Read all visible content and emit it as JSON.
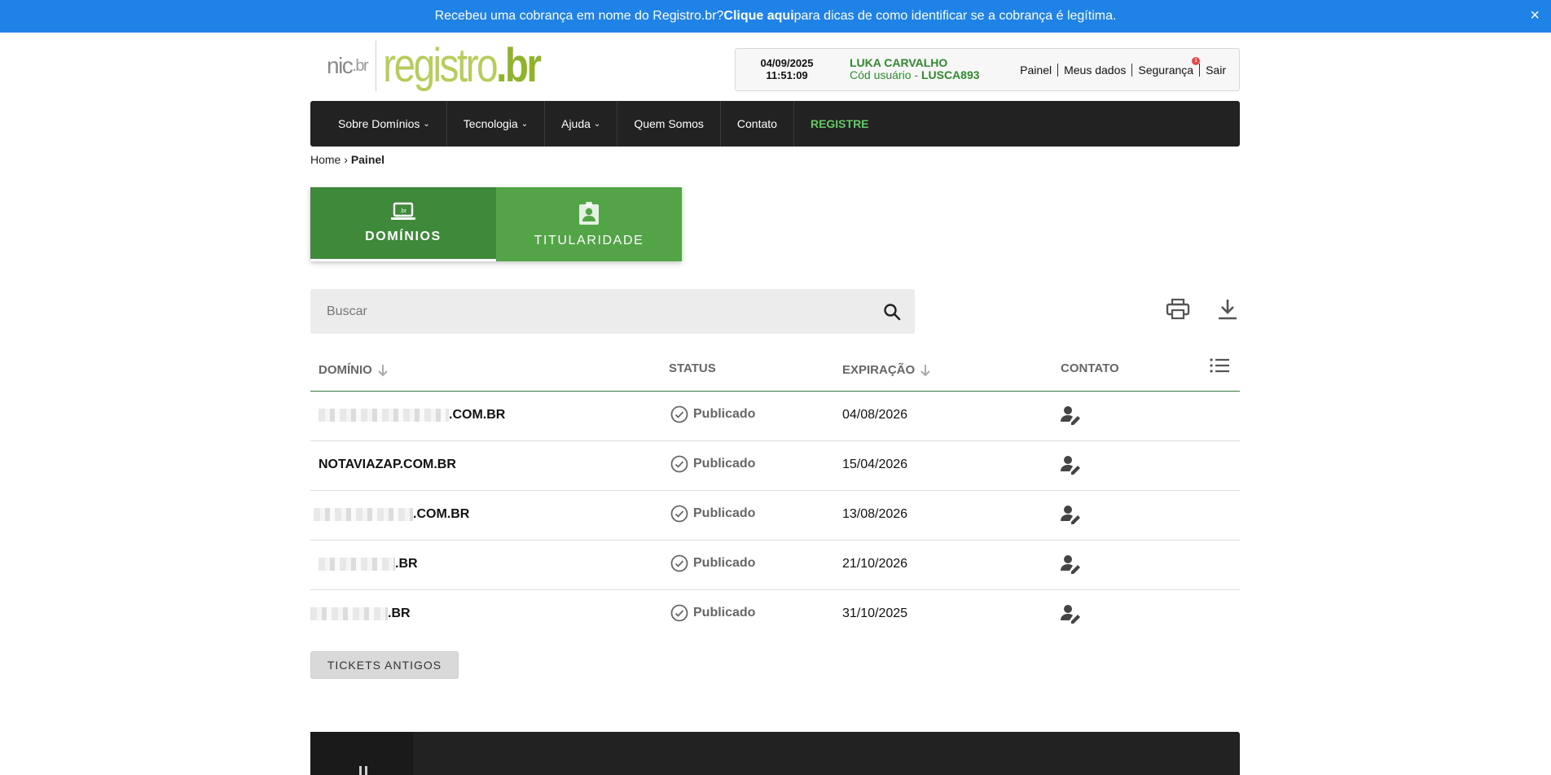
{
  "banner": {
    "text_before": "Recebeu uma cobrança em nome do Registro.br? ",
    "link": "Clique aqui",
    "text_after": " para dicas de como identificar se a cobrança é legítima.",
    "close": "×"
  },
  "logo": {
    "nic": "nic",
    "nic_suffix": ".br",
    "registro": "registro",
    "br": ".br"
  },
  "userbox": {
    "date": "04/09/2025",
    "time": "11:51:09",
    "user_name": "LUKA CARVALHO",
    "user_code_label": "Cód usuário - ",
    "user_code": "LUSCA893",
    "links": {
      "painel": "Painel",
      "meus_dados": "Meus dados",
      "seguranca": "Segurança",
      "seguranca_badge": "1",
      "sair": "Sair"
    }
  },
  "nav": [
    {
      "label": "Sobre Domínios",
      "dropdown": true
    },
    {
      "label": "Tecnologia",
      "dropdown": true
    },
    {
      "label": "Ajuda",
      "dropdown": true
    },
    {
      "label": "Quem Somos",
      "dropdown": false
    },
    {
      "label": "Contato",
      "dropdown": false
    },
    {
      "label": "REGISTRE",
      "dropdown": false
    }
  ],
  "breadcrumb": {
    "home": "Home",
    "sep": "›",
    "current": "Painel"
  },
  "tabs": [
    {
      "label": "DOMÍNIOS",
      "icon": "laptop-icon",
      "active": true
    },
    {
      "label": "TITULARIDADE",
      "icon": "clipboard-account-icon",
      "active": false
    }
  ],
  "search": {
    "placeholder": "Buscar",
    "value": ""
  },
  "table": {
    "headers": {
      "domain": "DOMÍNIO",
      "status": "STATUS",
      "expiration": "EXPIRAÇÃO",
      "contact": "CONTATO"
    },
    "rows": [
      {
        "domain_suffix": ".COM.BR",
        "redacted": true,
        "status": "Publicado",
        "expiration": "04/08/2026"
      },
      {
        "domain_suffix": "NOTAVIAZAP.COM.BR",
        "redacted": false,
        "status": "Publicado",
        "expiration": "15/04/2026"
      },
      {
        "domain_suffix": ".COM.BR",
        "redacted": true,
        "status": "Publicado",
        "expiration": "13/08/2026"
      },
      {
        "domain_suffix": ".BR",
        "redacted": true,
        "status": "Publicado",
        "expiration": "21/10/2026"
      },
      {
        "domain_suffix": ".BR",
        "redacted": true,
        "status": "Publicado",
        "expiration": "31/10/2025"
      }
    ]
  },
  "tickets_button": "TICKETS ANTIGOS",
  "colors": {
    "banner": "#1e82e6",
    "nav": "#222222",
    "tab_active": "#3e8a3a",
    "tab_inactive": "#52a447",
    "accent_green": "#2f8a2f",
    "registre": "#65c965"
  }
}
